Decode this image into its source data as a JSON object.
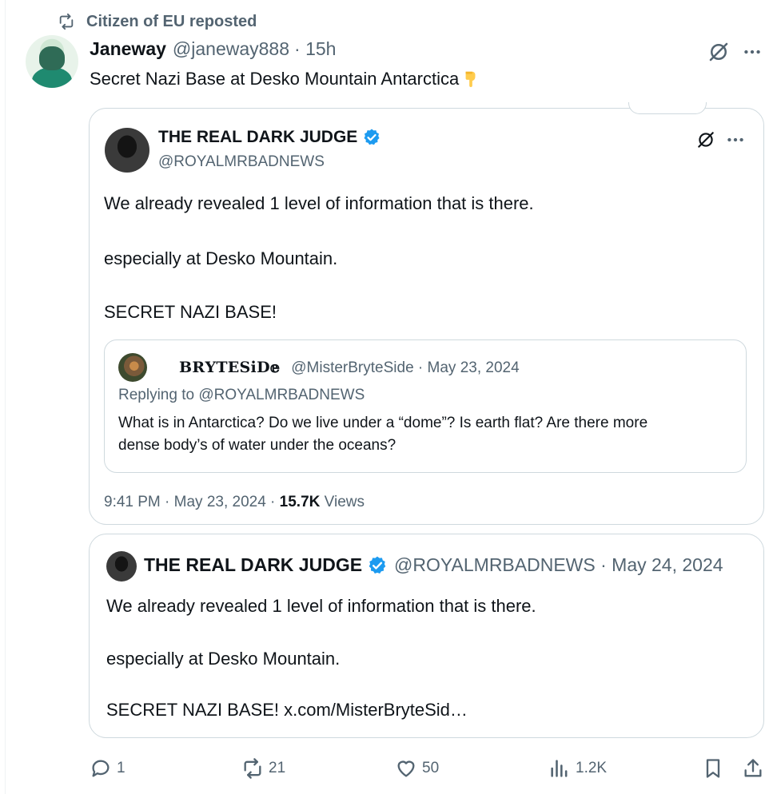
{
  "repost": {
    "text": "Citizen of EU reposted"
  },
  "tweet": {
    "author_name": "Janeway",
    "author_handle": "@janeway888",
    "time": "· 15h",
    "text": "Secret Nazi Base at Desko Mountain Antarctica"
  },
  "quote1": {
    "name": "THE REAL DARK JUDGE",
    "handle": "@ROYALMRBADNEWS",
    "lines": [
      "We already revealed 1 level of information that is there.",
      "especially at Desko Mountain.",
      "SECRET NAZI BASE!"
    ],
    "time": "9:41 PM · May 23, 2024 · ",
    "views_count": "15.7K",
    "views_label": " Views"
  },
  "quote2": {
    "name": "𝐁𝐑𝐘𝐓𝐄𝐒𝐢𝐃𝕖",
    "handle_date": "@MisterBryteSide · May 23, 2024",
    "replying": "Replying to @ROYALMRBADNEWS",
    "lines": [
      "What is in Antarctica? Do we live under a “dome”? Is earth flat? Are there more",
      "dense body’s of water  under the oceans?"
    ]
  },
  "quote3": {
    "name": "THE REAL DARK JUDGE",
    "handle_date": "@ROYALMRBADNEWS · May 24, 2024",
    "lines": [
      "We already revealed 1 level of information that is there.",
      "especially at Desko Mountain.",
      "SECRET NAZI BASE! x.com/MisterBryteSid…"
    ]
  },
  "actions": {
    "reply_count": "1",
    "repost_count": "21",
    "like_count": "50",
    "views_count": "1.2K"
  },
  "icons": {
    "repost": "repost-icon",
    "grok": "grok-icon",
    "more": "more-icon",
    "verified": "verified-badge-icon",
    "reply": "reply-icon",
    "like": "heart-icon",
    "views": "analytics-icon",
    "bookmark": "bookmark-icon",
    "share": "share-icon",
    "emoji": "pointing-down-emoji"
  },
  "colors": {
    "text": "#0f1419",
    "muted": "#536471",
    "verified": "#1d9bf0",
    "border": "#cfd9de"
  }
}
